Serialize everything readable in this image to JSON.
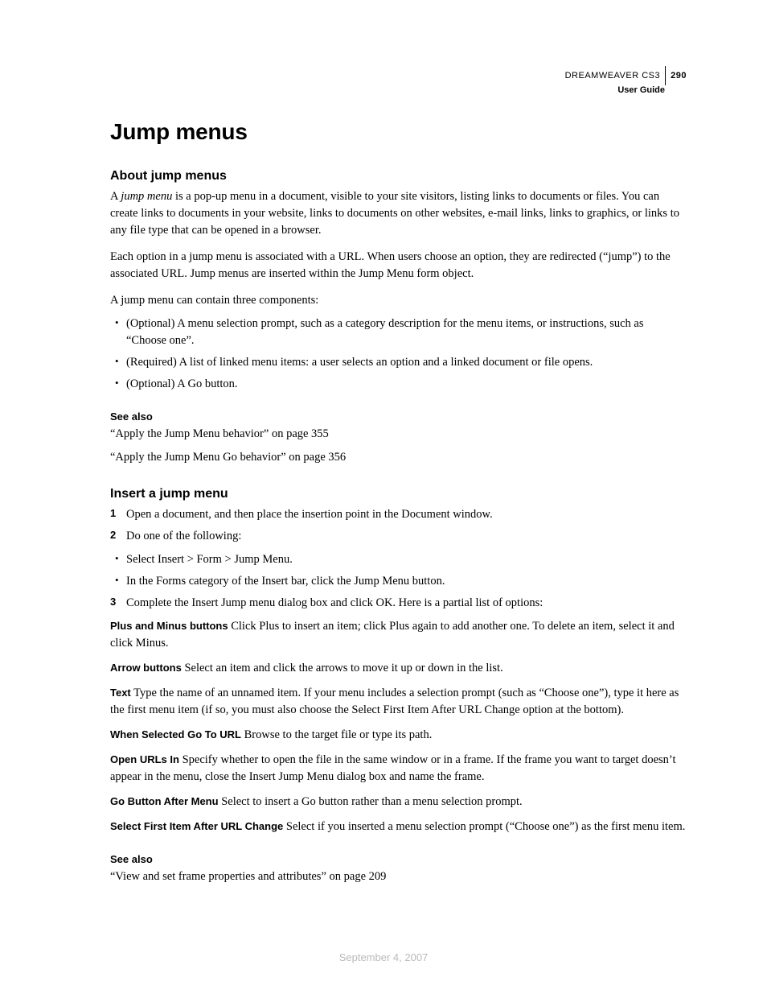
{
  "header": {
    "product": "DREAMWEAVER CS3",
    "page_number": "290",
    "subtitle": "User Guide"
  },
  "chapter_title": "Jump menus",
  "section_about": {
    "title": "About jump menus",
    "p1_a": "A ",
    "p1_term": "jump menu",
    "p1_b": " is a pop-up menu in a document, visible to your site visitors, listing links to documents or files. You can create links to documents in your website, links to documents on other websites, e-mail links, links to graphics, or links to any file type that can be opened in a browser.",
    "p2": "Each option in a jump menu is associated with a URL. When users choose an option, they are redirected (“jump”) to the associated URL. Jump menus are inserted within the Jump Menu form object.",
    "p3": "A jump menu can contain three components:",
    "bullets": [
      "(Optional) A menu selection prompt, such as a category description for the menu items, or instructions, such as “Choose one”.",
      "(Required) A list of linked menu items: a user selects an option and a linked document or file opens.",
      "(Optional) A Go button."
    ]
  },
  "see_also_1": {
    "title": "See also",
    "items": [
      "“Apply the Jump Menu behavior” on page 355",
      "“Apply the Jump Menu Go behavior” on page 356"
    ]
  },
  "section_insert": {
    "title": "Insert a jump menu",
    "steps": {
      "s1": "Open a document, and then place the insertion point in the Document window.",
      "s2": "Do one of the following:",
      "s2_bullets": [
        "Select Insert > Form > Jump Menu.",
        "In the Forms category of the Insert bar, click the Jump Menu button."
      ],
      "s3": "Complete the Insert Jump menu dialog box and click OK. Here is a partial list of options:"
    },
    "defs": [
      {
        "term": "Plus and Minus buttons",
        "text": "  Click Plus to insert an item; click Plus again to add another one. To delete an item, select it and click Minus."
      },
      {
        "term": "Arrow buttons",
        "text": "  Select an item and click the arrows to move it up or down in the list."
      },
      {
        "term": "Text",
        "text": "  Type the name of an unnamed item. If your menu includes a selection prompt (such as “Choose one”), type it here as the first menu item (if so, you must also choose the Select First Item After URL Change option at the bottom)."
      },
      {
        "term": "When Selected Go To URL",
        "text": "  Browse to the target file or type its path."
      },
      {
        "term": "Open URLs In",
        "text": "  Specify whether to open the file in the same window or in a frame. If the frame you want to target doesn’t appear in the menu, close the Insert Jump Menu dialog box and name the frame."
      },
      {
        "term": "Go Button After Menu",
        "text": "  Select to insert a Go button rather than a menu selection prompt."
      },
      {
        "term": "Select First Item After URL Change",
        "text": "  Select if you inserted a menu selection prompt (“Choose one”) as the first menu item."
      }
    ]
  },
  "see_also_2": {
    "title": "See also",
    "items": [
      "“View and set frame properties and attributes” on page 209"
    ]
  },
  "footer_date": "September 4, 2007"
}
